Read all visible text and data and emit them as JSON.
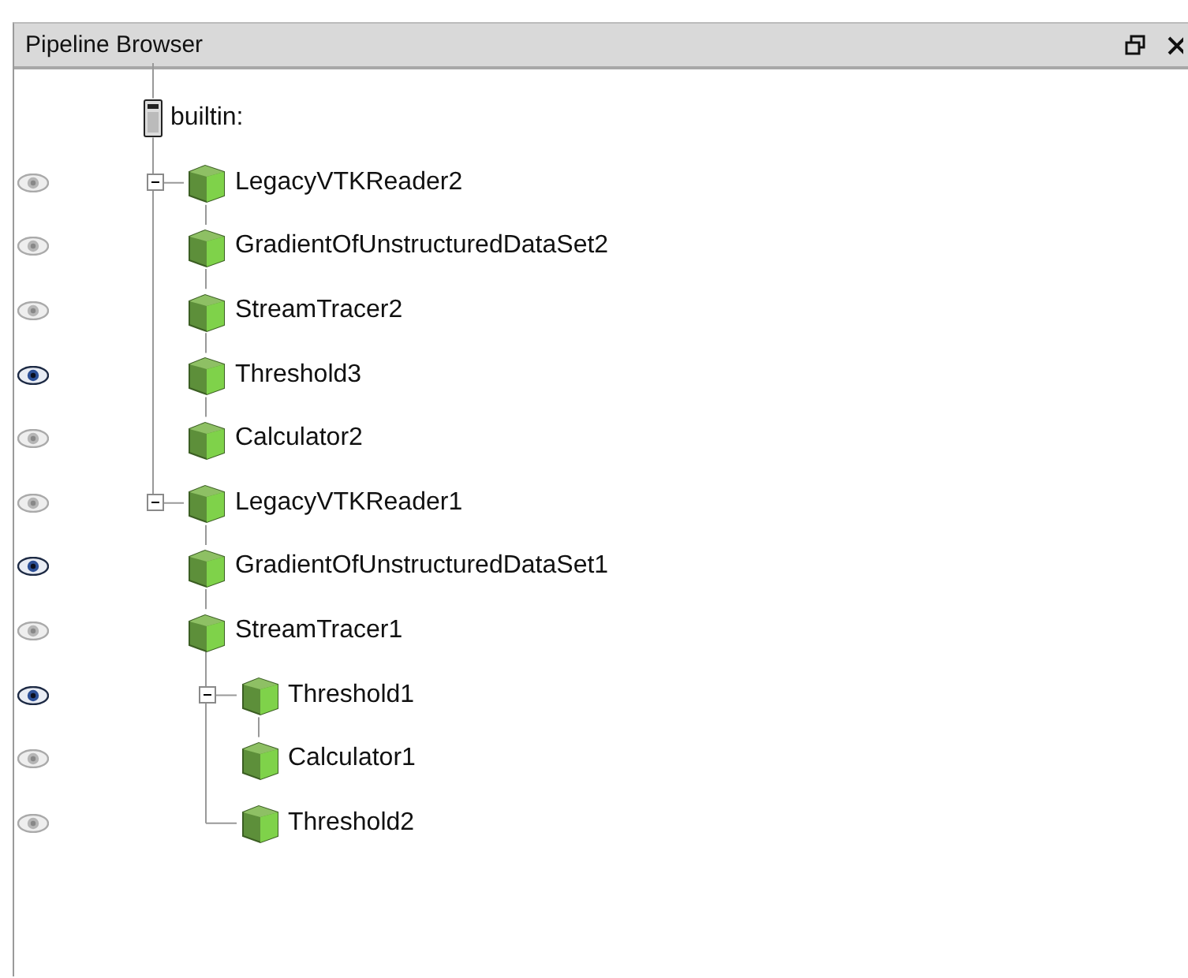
{
  "panel": {
    "title": "Pipeline Browser"
  },
  "tree": {
    "label": "builtin:",
    "kind": "server",
    "children": [
      {
        "label": "LegacyVTKReader2",
        "kind": "source",
        "visible": false,
        "expanded": true,
        "children": [
          {
            "label": "GradientOfUnstructuredDataSet2",
            "kind": "source",
            "visible": false,
            "children": [
              {
                "label": "StreamTracer2",
                "kind": "source",
                "visible": false,
                "children": [
                  {
                    "label": "Threshold3",
                    "kind": "source",
                    "visible": true,
                    "children": [
                      {
                        "label": "Calculator2",
                        "kind": "source",
                        "visible": false
                      }
                    ]
                  }
                ]
              }
            ]
          }
        ]
      },
      {
        "label": "LegacyVTKReader1",
        "kind": "source",
        "visible": false,
        "expanded": true,
        "children": [
          {
            "label": "GradientOfUnstructuredDataSet1",
            "kind": "source",
            "visible": true,
            "children": [
              {
                "label": "StreamTracer1",
                "kind": "source",
                "visible": false,
                "children": [
                  {
                    "label": "Threshold1",
                    "kind": "source",
                    "visible": true,
                    "expanded": true,
                    "children": [
                      {
                        "label": "Calculator1",
                        "kind": "source",
                        "visible": false
                      }
                    ]
                  },
                  {
                    "label": "Threshold2",
                    "kind": "source",
                    "visible": false
                  }
                ]
              }
            ]
          }
        ]
      }
    ]
  }
}
